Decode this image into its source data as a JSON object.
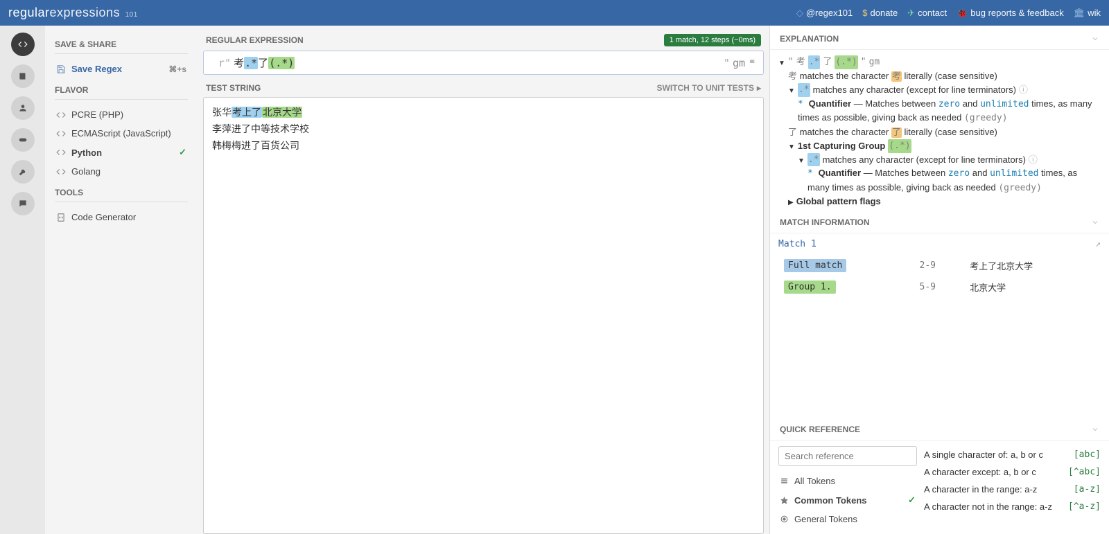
{
  "header": {
    "logo_main": "regular",
    "logo_secondary": "expressions",
    "logo_sub": "101",
    "links": {
      "twitter": "@regex101",
      "donate": "donate",
      "contact": "contact",
      "bugs": "bug reports & feedback",
      "wiki": "wik"
    }
  },
  "rail": {
    "items": [
      "code",
      "book",
      "user",
      "game",
      "wrench",
      "chat"
    ]
  },
  "left": {
    "save_share": "SAVE & SHARE",
    "save_regex": "Save Regex",
    "shortcut": "⌘+s",
    "flavor": "FLAVOR",
    "flavors": [
      {
        "label": "PCRE (PHP)",
        "active": false
      },
      {
        "label": "ECMAScript (JavaScript)",
        "active": false
      },
      {
        "label": "Python",
        "active": true
      },
      {
        "label": "Golang",
        "active": false
      }
    ],
    "tools": "TOOLS",
    "code_generator": "Code Generator"
  },
  "center": {
    "regex_title": "REGULAR EXPRESSION",
    "badge": "1 match, 12 steps (~0ms)",
    "regex_prefix": "r\"",
    "regex_part1": "考",
    "regex_part2": ".*",
    "regex_part3": "了",
    "regex_part4": "(.*)",
    "regex_suffix": "\"",
    "regex_flags": "gm",
    "test_title": "TEST STRING",
    "switch_link": "SWITCH TO UNIT TESTS",
    "test_lines": {
      "l1a": "张华",
      "l1b_blue": "考上了",
      "l1c_green": "北京大学",
      "l2": "李萍进了中等技术学校",
      "l3": "韩梅梅进了百货公司"
    }
  },
  "right": {
    "explanation_title": "EXPLANATION",
    "pattern_display_open": "\" ",
    "pattern_display_close": " \"",
    "flags_text": "gm",
    "exp_l1a": "考",
    "exp_l1b": " matches the character ",
    "exp_l1c": " literally (case sensitive)",
    "exp_dot": ".*",
    "exp_any": " matches any character (except for line terminators) ",
    "exp_quant_lead": "* ",
    "exp_quant_label": "Quantifier",
    "exp_quant_rest": " — Matches between ",
    "exp_zero": "zero",
    "exp_and": " and ",
    "exp_unlimited": "unlimited",
    "exp_times": " times, as many times as possible, giving back as needed ",
    "exp_greedy": "(greedy)",
    "exp_l3a": "了",
    "exp_group": "1st Capturing Group ",
    "exp_group_tok": "(.*)",
    "exp_global": "Global pattern flags",
    "match_title": "MATCH INFORMATION",
    "match1": "Match 1",
    "rows": [
      {
        "tag": "Full match",
        "cls": "tag-blue",
        "range": "2-9",
        "val": "考上了北京大学"
      },
      {
        "tag": "Group 1.",
        "cls": "tag-green",
        "range": "5-9",
        "val": "北京大学"
      }
    ],
    "quickref_title": "QUICK REFERENCE",
    "search_placeholder": "Search reference",
    "qr_cats": [
      {
        "label": "All Tokens",
        "active": false
      },
      {
        "label": "Common Tokens",
        "active": true
      },
      {
        "label": "General Tokens",
        "active": false
      }
    ],
    "qr_rows": [
      {
        "desc": "A single character of: a, b or c",
        "tok": "[abc]"
      },
      {
        "desc": "A character except: a, b or c",
        "tok": "[^abc]"
      },
      {
        "desc": "A character in the range: a-z",
        "tok": "[a-z]"
      },
      {
        "desc": "A character not in the range: a-z",
        "tok": "[^a-z]"
      }
    ]
  }
}
